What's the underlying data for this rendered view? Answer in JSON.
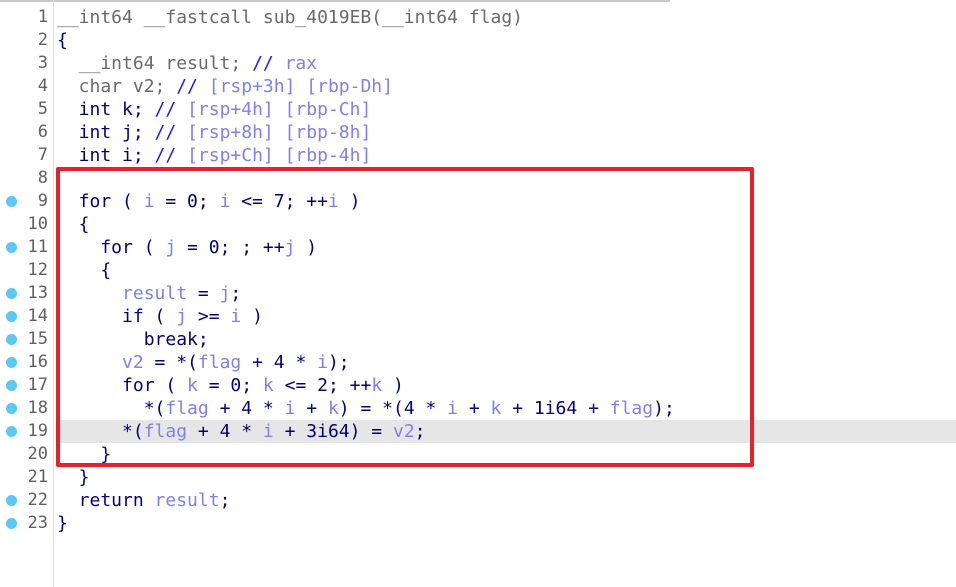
{
  "colors": {
    "highlight": "#e6e6e6",
    "breakpoint": "#5cc8f6",
    "annotation_box": "#e8202a"
  },
  "lines": [
    {
      "n": "1",
      "bp": false,
      "segs": [
        [
          "__int64 __fastcall sub_4019EB(__int64 flag)",
          "g"
        ]
      ]
    },
    {
      "n": "2",
      "bp": false,
      "segs": [
        [
          "{",
          "n"
        ]
      ]
    },
    {
      "n": "3",
      "bp": false,
      "segs": [
        [
          "  __int64 result; ",
          "g"
        ],
        [
          "// ",
          "c"
        ],
        [
          "rax",
          "v"
        ]
      ]
    },
    {
      "n": "4",
      "bp": false,
      "segs": [
        [
          "  char v2; ",
          "g"
        ],
        [
          "// ",
          "c"
        ],
        [
          "[rsp+3h] [rbp-Dh]",
          "v"
        ]
      ]
    },
    {
      "n": "5",
      "bp": false,
      "segs": [
        [
          "  int k; ",
          "n"
        ],
        [
          "// ",
          "c"
        ],
        [
          "[rsp+4h] [rbp-Ch]",
          "v"
        ]
      ]
    },
    {
      "n": "6",
      "bp": false,
      "segs": [
        [
          "  int j; ",
          "n"
        ],
        [
          "// ",
          "c"
        ],
        [
          "[rsp+8h] [rbp-8h]",
          "v"
        ]
      ]
    },
    {
      "n": "7",
      "bp": false,
      "segs": [
        [
          "  int i; ",
          "n"
        ],
        [
          "// ",
          "c"
        ],
        [
          "[rsp+Ch] [rbp-4h]",
          "v"
        ]
      ]
    },
    {
      "n": "8",
      "bp": false,
      "segs": []
    },
    {
      "n": "9",
      "bp": true,
      "segs": [
        [
          "  for ( ",
          "n"
        ],
        [
          "i",
          "v"
        ],
        [
          " = 0; ",
          "n"
        ],
        [
          "i",
          "v"
        ],
        [
          " <= 7; ++",
          "n"
        ],
        [
          "i",
          "v"
        ],
        [
          " )",
          "n"
        ]
      ]
    },
    {
      "n": "10",
      "bp": false,
      "segs": [
        [
          "  {",
          "n"
        ]
      ]
    },
    {
      "n": "11",
      "bp": true,
      "segs": [
        [
          "    for ( ",
          "n"
        ],
        [
          "j",
          "v"
        ],
        [
          " = 0; ; ++",
          "n"
        ],
        [
          "j",
          "v"
        ],
        [
          " )",
          "n"
        ]
      ]
    },
    {
      "n": "12",
      "bp": false,
      "segs": [
        [
          "    {",
          "n"
        ]
      ]
    },
    {
      "n": "13",
      "bp": true,
      "segs": [
        [
          "      ",
          "n"
        ],
        [
          "result",
          "v"
        ],
        [
          " = ",
          "n"
        ],
        [
          "j",
          "v"
        ],
        [
          ";",
          "n"
        ]
      ]
    },
    {
      "n": "14",
      "bp": true,
      "segs": [
        [
          "      if ( ",
          "n"
        ],
        [
          "j",
          "v"
        ],
        [
          " >= ",
          "n"
        ],
        [
          "i",
          "v"
        ],
        [
          " )",
          "n"
        ]
      ]
    },
    {
      "n": "15",
      "bp": true,
      "segs": [
        [
          "        break;",
          "n"
        ]
      ]
    },
    {
      "n": "16",
      "bp": true,
      "segs": [
        [
          "      ",
          "n"
        ],
        [
          "v2",
          "v"
        ],
        [
          " = *(",
          "n"
        ],
        [
          "flag",
          "v"
        ],
        [
          " + 4 * ",
          "n"
        ],
        [
          "i",
          "v"
        ],
        [
          ");",
          "n"
        ]
      ]
    },
    {
      "n": "17",
      "bp": true,
      "segs": [
        [
          "      for ( ",
          "n"
        ],
        [
          "k",
          "v"
        ],
        [
          " = 0; ",
          "n"
        ],
        [
          "k",
          "v"
        ],
        [
          " <= 2; ++",
          "n"
        ],
        [
          "k",
          "v"
        ],
        [
          " )",
          "n"
        ]
      ]
    },
    {
      "n": "18",
      "bp": true,
      "segs": [
        [
          "        *(",
          "n"
        ],
        [
          "flag",
          "v"
        ],
        [
          " + 4 * ",
          "n"
        ],
        [
          "i",
          "v"
        ],
        [
          " + ",
          "n"
        ],
        [
          "k",
          "v"
        ],
        [
          ") = *(4 * ",
          "n"
        ],
        [
          "i",
          "v"
        ],
        [
          " + ",
          "n"
        ],
        [
          "k",
          "v"
        ],
        [
          " + 1i64 + ",
          "n"
        ],
        [
          "flag",
          "v"
        ],
        [
          ");",
          "n"
        ]
      ]
    },
    {
      "n": "19",
      "bp": true,
      "hl": true,
      "segs": [
        [
          "      *(",
          "n"
        ],
        [
          "flag",
          "v"
        ],
        [
          " + 4 * ",
          "n"
        ],
        [
          "i",
          "v"
        ],
        [
          " + 3i64) = ",
          "n"
        ],
        [
          "v2",
          "v"
        ],
        [
          ";",
          "n"
        ]
      ]
    },
    {
      "n": "20",
      "bp": false,
      "segs": [
        [
          "    }",
          "n"
        ]
      ]
    },
    {
      "n": "21",
      "bp": false,
      "segs": [
        [
          "  }",
          "n"
        ]
      ]
    },
    {
      "n": "22",
      "bp": true,
      "segs": [
        [
          "  return ",
          "n"
        ],
        [
          "result",
          "v"
        ],
        [
          ";",
          "n"
        ]
      ]
    },
    {
      "n": "23",
      "bp": true,
      "segs": [
        [
          "}",
          "n"
        ]
      ]
    }
  ]
}
